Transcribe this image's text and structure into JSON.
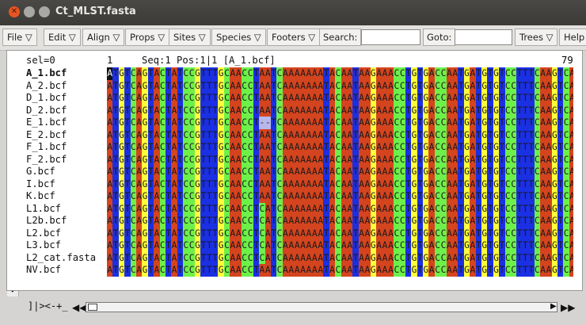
{
  "window": {
    "title": "Ct_MLST.fasta"
  },
  "toolbar": {
    "menus": [
      "File ▽",
      "Edit ▽",
      "Align ▽",
      "Props ▽",
      "Sites ▽",
      "Species ▽",
      "Footers ▽"
    ],
    "search_label": "Search:",
    "search_value": "",
    "goto_label": "Goto:",
    "goto_value": "",
    "trees_label": "Trees ▽",
    "help_label": "Help"
  },
  "alignment": {
    "selection_label": "sel=0",
    "start_position": "1",
    "status_text": "Seq:1 Pos:1|1 [A_1.bcf]",
    "end_position": "79",
    "sequence_names": [
      "A_1.bcf",
      "A_2.bcf",
      "D_1.bcf",
      "D_2.bcf",
      "E_1.bcf",
      "E_2.bcf",
      "F_1.bcf",
      "F_2.bcf",
      "G.bcf",
      "I.bcf",
      "K.bcf",
      "L1.bcf",
      "L2b.bcf",
      "L2.bcf",
      "L3.bcf",
      "L2_cat.fasta",
      "NV.bcf"
    ],
    "selected_sequence": "A_1.bcf",
    "base_sequence": "ATGTCAGTACTATCCGTTTGCAACCTAATCAAAAAAATACAATAAGAAACCTGTGACCAATGATGTGTCCTTTCAAGTCA",
    "sequence_variants": [
      {
        "row": 4,
        "position": 26,
        "char": "-"
      },
      {
        "row": 4,
        "position": 27,
        "char": "-"
      },
      {
        "row": 11,
        "position": 26,
        "char": "C"
      },
      {
        "row": 11,
        "position": 70,
        "char": "T"
      },
      {
        "row": 12,
        "position": 26,
        "char": "C"
      },
      {
        "row": 12,
        "position": 70,
        "char": "T"
      },
      {
        "row": 13,
        "position": 26,
        "char": "C"
      },
      {
        "row": 14,
        "position": 26,
        "char": "C"
      },
      {
        "row": 14,
        "position": 70,
        "char": "T"
      },
      {
        "row": 15,
        "position": 26,
        "char": "C"
      },
      {
        "row": 15,
        "position": 70,
        "char": "T"
      }
    ],
    "colors": {
      "A": "#d4441e",
      "T": "#1b2fe3",
      "G": "#ffff3c",
      "C": "#6ef04a",
      "gap": "#b7b7ea"
    }
  },
  "bottom_bar": {
    "text": "]|><-+_"
  }
}
